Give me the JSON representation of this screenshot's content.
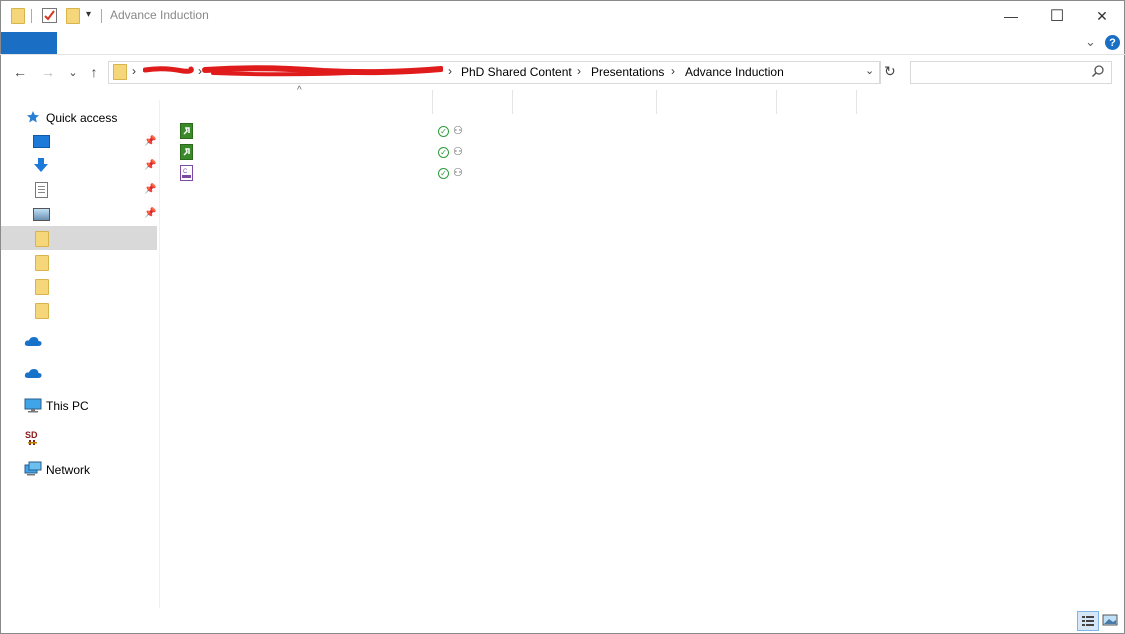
{
  "window": {
    "title": "Advance Induction",
    "minimize": "—",
    "maximize": "☐",
    "close": "✕"
  },
  "ribbon": {
    "help_label": "?",
    "expand_label": "⌄"
  },
  "nav": {
    "back": "←",
    "forward": "→",
    "recent": "⌄",
    "up": "↑",
    "refresh": "↻",
    "dropdown": "⌄"
  },
  "breadcrumb": {
    "items": [
      "PhD Shared Content",
      "Presentations",
      "Advance Induction"
    ],
    "separator": "›"
  },
  "search": {
    "placeholder": ""
  },
  "sidebar": {
    "quick_access": "Quick access",
    "this_pc": "This PC",
    "network": "Network"
  },
  "files": {
    "sort_indicator": "^",
    "rows": [
      {
        "icon": "green-document-icon",
        "status": "available"
      },
      {
        "icon": "green-document-icon",
        "status": "available"
      },
      {
        "icon": "purple-document-icon",
        "status": "available"
      }
    ]
  },
  "colors": {
    "accent": "#1a6fc4",
    "folder": "#f6d67a",
    "selected": "#d9d9d9",
    "status_green": "#2e9b3b",
    "redaction": "#e01b1b"
  }
}
